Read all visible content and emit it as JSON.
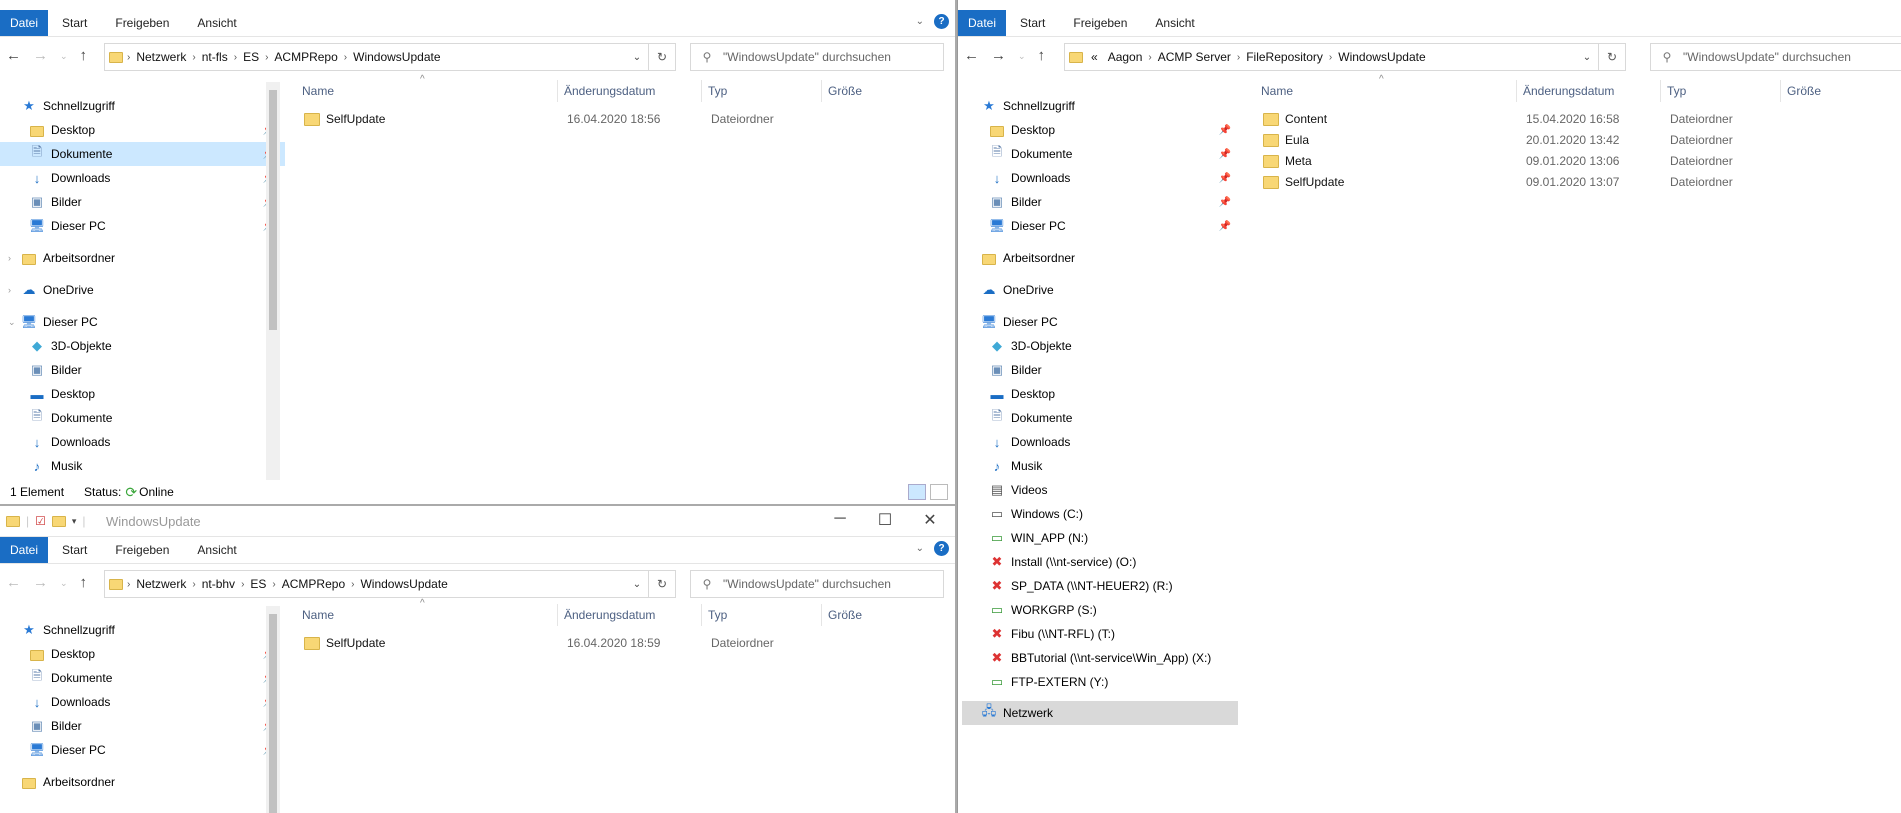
{
  "ribbon_tabs": [
    "Datei",
    "Start",
    "Freigeben",
    "Ansicht"
  ],
  "search_placeholder": "\"WindowsUpdate\" durchsuchen",
  "columns": {
    "name": "Name",
    "date": "Änderungsdatum",
    "type": "Typ",
    "size": "Größe"
  },
  "icons": {
    "folder": "folder-icon",
    "pin": "pin-icon",
    "back": "arrow-left-icon",
    "forward": "arrow-right-icon",
    "up": "arrow-up-icon",
    "refresh": "refresh-icon",
    "search": "search-icon",
    "help": "help-icon"
  },
  "colors": {
    "accent": "#1a6dc4",
    "selection": "#cce8ff",
    "folder": "#f8d775"
  },
  "w1": {
    "breadcrumb": [
      "Netzwerk",
      "nt-fls",
      "ES",
      "ACMPRepo",
      "WindowsUpdate"
    ],
    "nav": [
      "Schnellzugriff",
      "Desktop",
      "Dokumente",
      "Downloads",
      "Bilder",
      "Dieser PC",
      "Arbeitsordner",
      "OneDrive",
      "Dieser PC",
      "3D-Objekte",
      "Bilder",
      "Desktop",
      "Dokumente",
      "Downloads",
      "Musik"
    ],
    "files": [
      {
        "name": "SelfUpdate",
        "date": "16.04.2020 18:56",
        "type": "Dateiordner"
      }
    ],
    "status_count": "1 Element",
    "status_label": "Status:",
    "status_value": "Online"
  },
  "w2": {
    "title": "WindowsUpdate",
    "breadcrumb": [
      "Netzwerk",
      "nt-bhv",
      "ES",
      "ACMPRepo",
      "WindowsUpdate"
    ],
    "nav": [
      "Schnellzugriff",
      "Desktop",
      "Dokumente",
      "Downloads",
      "Bilder",
      "Dieser PC",
      "Arbeitsordner"
    ],
    "files": [
      {
        "name": "SelfUpdate",
        "date": "16.04.2020 18:59",
        "type": "Dateiordner"
      }
    ]
  },
  "w3": {
    "breadcrumb_prefix": "«",
    "breadcrumb": [
      "Aagon",
      "ACMP Server",
      "FileRepository",
      "WindowsUpdate"
    ],
    "nav": [
      "Schnellzugriff",
      "Desktop",
      "Dokumente",
      "Downloads",
      "Bilder",
      "Dieser PC",
      "Arbeitsordner",
      "OneDrive",
      "Dieser PC",
      "3D-Objekte",
      "Bilder",
      "Desktop",
      "Dokumente",
      "Downloads",
      "Musik",
      "Videos",
      "Windows (C:)",
      "WIN_APP (N:)",
      "Install (\\\\nt-service) (O:)",
      "SP_DATA (\\\\NT-HEUER2) (R:)",
      "WORKGRP (S:)",
      "Fibu (\\\\NT-RFL) (T:)",
      "BBTutorial (\\\\nt-service\\Win_App) (X:)",
      "FTP-EXTERN (Y:)",
      "Netzwerk"
    ],
    "files": [
      {
        "name": "Content",
        "date": "15.04.2020 16:58",
        "type": "Dateiordner"
      },
      {
        "name": "Eula",
        "date": "20.01.2020 13:42",
        "type": "Dateiordner"
      },
      {
        "name": "Meta",
        "date": "09.01.2020 13:06",
        "type": "Dateiordner"
      },
      {
        "name": "SelfUpdate",
        "date": "09.01.2020 13:07",
        "type": "Dateiordner"
      }
    ]
  }
}
